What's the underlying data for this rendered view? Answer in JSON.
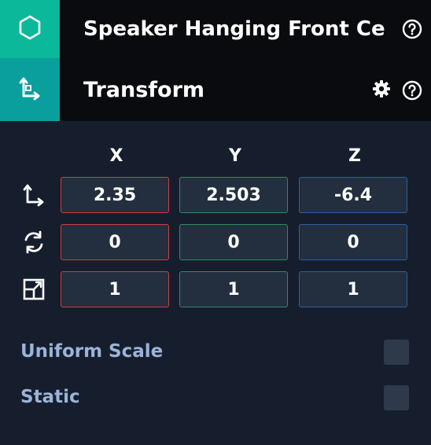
{
  "entity": {
    "name": "Speaker Hanging Front Ce...",
    "icon": "hexagon-icon"
  },
  "component": {
    "name": "Transform",
    "icon": "transform-axes-icon"
  },
  "icons": {
    "help": "question-circle-icon",
    "settings": "gear-icon"
  },
  "columns": [
    "X",
    "Y",
    "Z"
  ],
  "axis_colors": {
    "x": "#cf3d42",
    "y": "#2f8c5a",
    "z": "#2e5fa3"
  },
  "rows": [
    {
      "name": "position",
      "icon": "position-axes-icon",
      "values": [
        "2.35",
        "2.503",
        "-6.4"
      ]
    },
    {
      "name": "rotation",
      "icon": "rotation-arrows-icon",
      "values": [
        "0",
        "0",
        "0"
      ]
    },
    {
      "name": "scale",
      "icon": "scale-box-icon",
      "values": [
        "1",
        "1",
        "1"
      ]
    }
  ],
  "options": {
    "uniform_scale": {
      "label": "Uniform Scale",
      "checked": false
    },
    "static": {
      "label": "Static",
      "checked": false
    }
  },
  "colors": {
    "entity_icon_bg": "#0bb89a",
    "component_icon_bg": "#0a9f9c",
    "panel_bg": "#161e2d",
    "field_bg": "#232f3e",
    "option_label": "#9bb3d8"
  }
}
